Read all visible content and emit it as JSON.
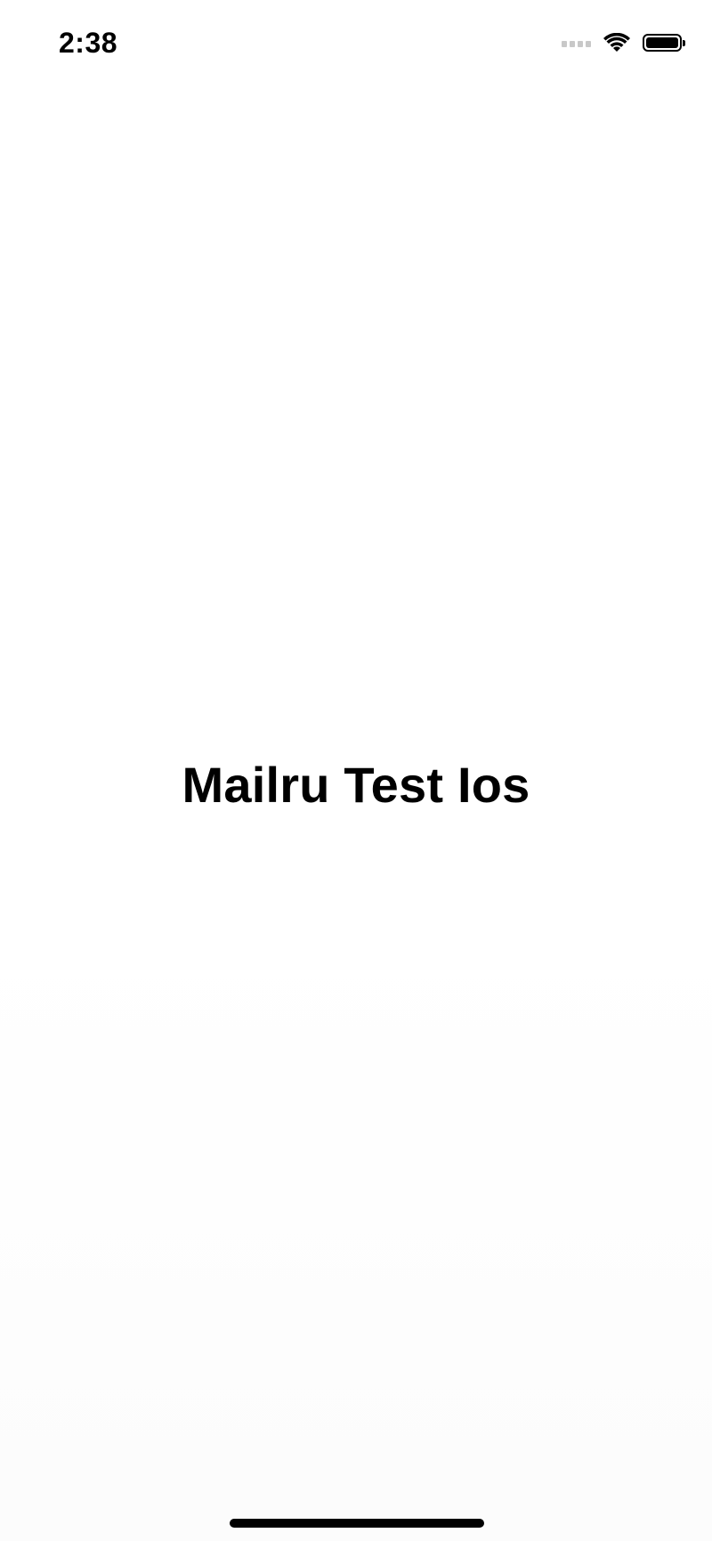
{
  "status_bar": {
    "time": "2:38",
    "signal_icon": "cellular-signal-icon",
    "wifi_icon": "wifi-icon",
    "battery_icon": "battery-icon",
    "battery_level": 1.0
  },
  "screen": {
    "title": "Mailru Test Ios"
  },
  "colors": {
    "background": "#ffffff",
    "text": "#000000",
    "signal_inactive": "#c8c8c8",
    "home_indicator": "#000000"
  }
}
